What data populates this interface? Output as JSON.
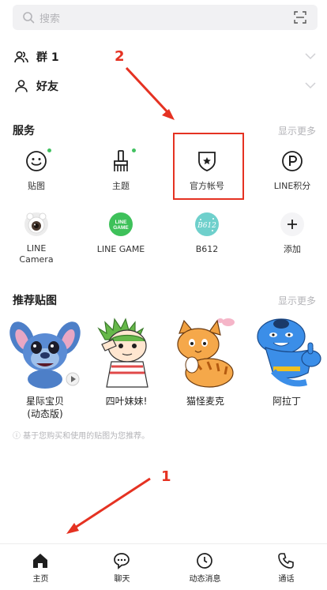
{
  "search": {
    "placeholder": "搜索"
  },
  "friends": {
    "groups_label": "群 1",
    "friends_label": "好友"
  },
  "services": {
    "title": "服务",
    "more": "显示更多",
    "items": [
      {
        "label": "贴图",
        "icon": "smiley-icon",
        "new_dot": true
      },
      {
        "label": "主题",
        "icon": "brush-icon",
        "new_dot": true
      },
      {
        "label": "官方帐号",
        "icon": "shield-star-icon",
        "new_dot": false
      },
      {
        "label": "LINE积分",
        "icon": "points-icon",
        "new_dot": false
      },
      {
        "label": "LINE\nCamera",
        "icon": "line-camera-icon",
        "new_dot": false
      },
      {
        "label": "LINE GAME",
        "icon": "line-game-icon",
        "new_dot": false
      },
      {
        "label": "B612",
        "icon": "b612-icon",
        "new_dot": false
      },
      {
        "label": "添加",
        "icon": "plus-icon",
        "new_dot": false
      }
    ],
    "line_game_badge": [
      "LINE",
      "GAME"
    ],
    "b612_badge": "B612"
  },
  "stickers": {
    "title": "推荐贴图",
    "more": "显示更多",
    "items": [
      {
        "name": "星际宝贝\n(动态版)",
        "art": "stitch-sticker"
      },
      {
        "name": "四叶妹妹!",
        "art": "yotsuba-sticker"
      },
      {
        "name": "猫怪麦克",
        "art": "cat-sticker"
      },
      {
        "name": "阿拉丁",
        "art": "genie-sticker"
      }
    ],
    "note": "ⓘ 基于您购买和使用的贴图为您推荐。"
  },
  "annotations": {
    "one": "1",
    "two": "2",
    "color": "#e53222"
  },
  "tabbar": {
    "tabs": [
      {
        "label": "主页",
        "icon": "home-icon",
        "active": true
      },
      {
        "label": "聊天",
        "icon": "chat-icon",
        "active": false
      },
      {
        "label": "动态消息",
        "icon": "clock-icon",
        "active": false
      },
      {
        "label": "通话",
        "icon": "phone-icon",
        "active": false
      }
    ]
  },
  "colors": {
    "accent_green": "#42c161",
    "highlight_red": "#e53222"
  }
}
